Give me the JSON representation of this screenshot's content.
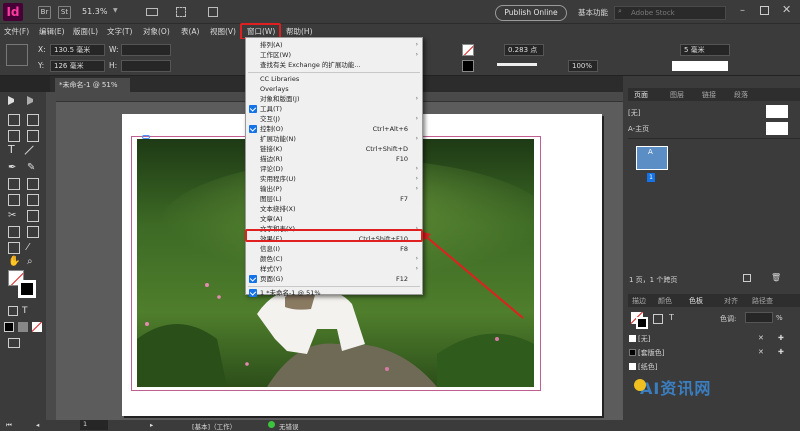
{
  "app": {
    "logo": "Id",
    "bridge": "Br",
    "stock": "St",
    "zoom": "51.3%",
    "publish": "Publish Online",
    "workspace": "基本功能",
    "search_placeholder": "Adobe Stock"
  },
  "menu": [
    "文件(F)",
    "编辑(E)",
    "版面(L)",
    "文字(T)",
    "对象(O)",
    "表(A)",
    "视图(V)",
    "窗口(W)",
    "帮助(H)"
  ],
  "control": {
    "x_label": "X:",
    "x_value": "130.5 毫米",
    "y_label": "Y:",
    "y_value": "126 毫米",
    "w_label": "W:",
    "h_label": "H:",
    "stroke": "0.283 点",
    "percent": "100%",
    "gap": "5 毫米"
  },
  "document": {
    "tab": "*未命名-1 @ 51%"
  },
  "window_menu": [
    {
      "label": "排列(A)",
      "shortcut": "",
      "submenu": true,
      "checked": false
    },
    {
      "label": "工作区(W)",
      "shortcut": "",
      "submenu": true,
      "checked": false
    },
    {
      "label": "查找有关 Exchange 的扩展功能...",
      "shortcut": "",
      "submenu": false,
      "checked": false,
      "sep_after": true
    },
    {
      "label": "CC Libraries",
      "shortcut": "",
      "submenu": false,
      "checked": false
    },
    {
      "label": "Overlays",
      "shortcut": "",
      "submenu": false,
      "checked": false
    },
    {
      "label": "对象和版面(J)",
      "shortcut": "",
      "submenu": true,
      "checked": false
    },
    {
      "label": "工具(T)",
      "shortcut": "",
      "submenu": false,
      "checked": true
    },
    {
      "label": "交互(J)",
      "shortcut": "",
      "submenu": true,
      "checked": false
    },
    {
      "label": "控制(O)",
      "shortcut": "Ctrl+Alt+6",
      "submenu": false,
      "checked": true
    },
    {
      "label": "扩展功能(N)",
      "shortcut": "",
      "submenu": true,
      "checked": false
    },
    {
      "label": "链接(K)",
      "shortcut": "Ctrl+Shift+D",
      "submenu": false,
      "checked": false
    },
    {
      "label": "描边(R)",
      "shortcut": "F10",
      "submenu": false,
      "checked": false
    },
    {
      "label": "评论(D)",
      "shortcut": "",
      "submenu": true,
      "checked": false
    },
    {
      "label": "实用程序(U)",
      "shortcut": "",
      "submenu": true,
      "checked": false
    },
    {
      "label": "输出(P)",
      "shortcut": "",
      "submenu": true,
      "checked": false
    },
    {
      "label": "图层(L)",
      "shortcut": "F7",
      "submenu": false,
      "checked": false
    },
    {
      "label": "文本绕排(X)",
      "shortcut": "",
      "submenu": false,
      "checked": false
    },
    {
      "label": "文章(A)",
      "shortcut": "",
      "submenu": false,
      "checked": false
    },
    {
      "label": "文字和表(Y)",
      "shortcut": "",
      "submenu": true,
      "checked": false
    },
    {
      "label": "效果(E)",
      "shortcut": "Ctrl+Shift+F10",
      "submenu": false,
      "checked": false
    },
    {
      "label": "信息(I)",
      "shortcut": "F8",
      "submenu": false,
      "checked": false
    },
    {
      "label": "颜色(C)",
      "shortcut": "",
      "submenu": true,
      "checked": false
    },
    {
      "label": "样式(Y)",
      "shortcut": "",
      "submenu": true,
      "checked": false
    },
    {
      "label": "页面(G)",
      "shortcut": "F12",
      "submenu": false,
      "checked": true,
      "sep_after": true
    },
    {
      "label": "1 *未命名-1 @ 51%",
      "shortcut": "",
      "submenu": false,
      "checked": true
    }
  ],
  "pages_panel": {
    "tabs": [
      "页面",
      "图层",
      "链接",
      "段落"
    ],
    "none": "[无]",
    "master": "A-主页",
    "page_letter": "A",
    "page_number": "1",
    "footer": "1 页，1 个跨页"
  },
  "swatch_panel": {
    "tabs": [
      "描边",
      "颜色",
      "色板",
      "对齐",
      "路径查"
    ],
    "tint_label": "色调:",
    "tint_unit": "%",
    "swatch_t": "T",
    "items": [
      "[无]",
      "[套版色]",
      "[纸色]"
    ]
  },
  "status": {
    "page": "1",
    "style": "[基本]（工作）",
    "errors": "无错误"
  },
  "watermark": "AI资讯网",
  "colors": {
    "accent": "#e02020",
    "panel": "#3b3b3b",
    "check": "#1473e6"
  }
}
